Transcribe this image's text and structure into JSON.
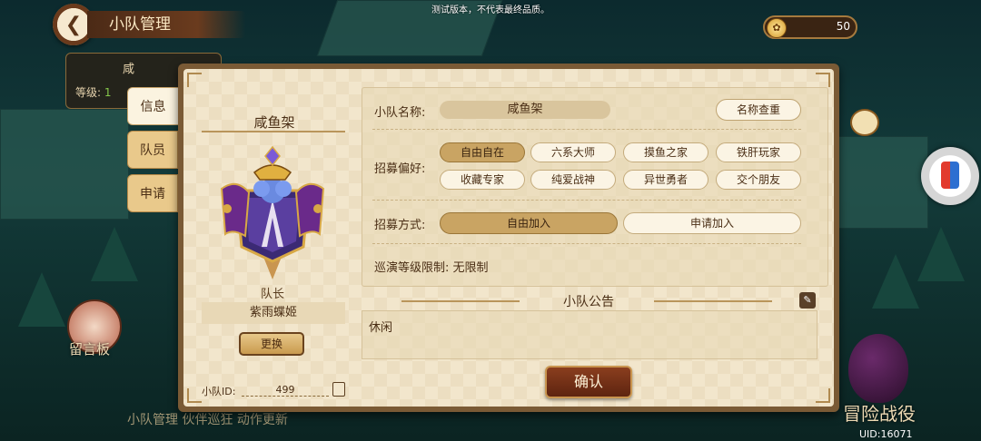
{
  "top_notice": "测试版本，不代表最终品质。",
  "header": {
    "title": "小队管理"
  },
  "currency": {
    "value": "50"
  },
  "side_panel": {
    "name": "咸",
    "level_label": "等级:",
    "level_value": "1"
  },
  "tabs": [
    {
      "label": "信息",
      "active": true
    },
    {
      "label": "队员",
      "active": false
    },
    {
      "label": "申请",
      "active": false
    }
  ],
  "team": {
    "name": "咸鱼架",
    "captain_label": "队长",
    "captain_name": "紫雨蝶姬",
    "change_label": "更换",
    "id_label": "小队ID:",
    "id_value": "499"
  },
  "form": {
    "name_label": "小队名称:",
    "name_value": "咸鱼架",
    "check_name_label": "名称查重",
    "pref_label": "招募偏好:",
    "prefs": [
      {
        "label": "自由自在",
        "selected": true
      },
      {
        "label": "六系大师",
        "selected": false
      },
      {
        "label": "摸鱼之家",
        "selected": false
      },
      {
        "label": "铁肝玩家",
        "selected": false
      },
      {
        "label": "收藏专家",
        "selected": false
      },
      {
        "label": "纯爱战神",
        "selected": false
      },
      {
        "label": "异世勇者",
        "selected": false
      },
      {
        "label": "交个朋友",
        "selected": false
      }
    ],
    "method_label": "招募方式:",
    "methods": [
      {
        "label": "自由加入",
        "selected": true
      },
      {
        "label": "申请加入",
        "selected": false
      }
    ],
    "level_limit": "巡演等级限制: 无限制"
  },
  "notice": {
    "title": "小队公告",
    "text": "休闲"
  },
  "confirm_label": "确认",
  "background": {
    "message_board": "留言板",
    "bottom_text": "小队管理  伙伴巡狂  动作更新",
    "adventure": "冒险战役",
    "uid": "UID:16071"
  },
  "colors": {
    "accent": "#c9a463",
    "confirm": "#6e2c14",
    "panel": "#f2e6cc"
  }
}
